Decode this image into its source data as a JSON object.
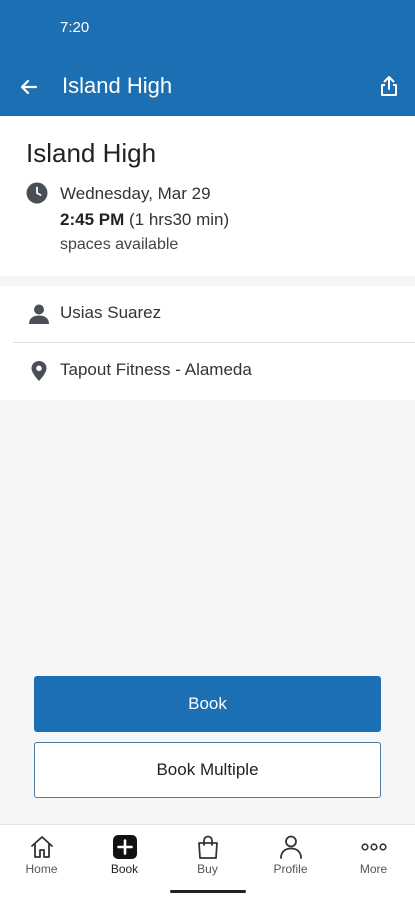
{
  "status_bar": {
    "time": "7:20"
  },
  "app_bar": {
    "title": "Island High"
  },
  "class_detail": {
    "title": "Island High",
    "date": "Wednesday, Mar 29",
    "start_time": "2:45 PM",
    "duration": "(1 hrs30 min)",
    "spaces": "spaces available"
  },
  "info": {
    "instructor": "Usias Suarez",
    "location": "Tapout Fitness - Alameda"
  },
  "actions": {
    "book_label": "Book",
    "book_multiple_label": "Book Multiple"
  },
  "bottom_nav": {
    "items": [
      {
        "label": "Home",
        "icon": "home-icon"
      },
      {
        "label": "Book",
        "icon": "plus-square-icon"
      },
      {
        "label": "Buy",
        "icon": "shopping-bag-icon"
      },
      {
        "label": "Profile",
        "icon": "person-icon"
      },
      {
        "label": "More",
        "icon": "more-dots-icon"
      }
    ]
  },
  "colors": {
    "primary": "#1d6fb3",
    "background": "#f4f6f8",
    "surface": "#ffffff"
  }
}
